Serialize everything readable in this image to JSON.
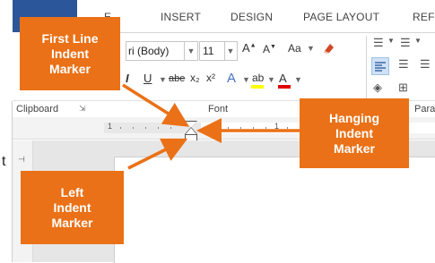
{
  "ribbon": {
    "tabs": [
      "E",
      "INSERT",
      "DESIGN",
      "PAGE LAYOUT",
      "REF"
    ],
    "font": {
      "name_value": "ri (Body)",
      "size_value": "11",
      "grow_label": "A",
      "shrink_label": "A",
      "case_label": "Aa",
      "italic_label": "I",
      "underline_label": "U",
      "strike_label": "abe",
      "subscript_label": "x₂",
      "superscript_label": "x²",
      "effect_label": "A",
      "highlight_label": "ab",
      "fontcolor_label": "A",
      "highlight_color": "#ffff00",
      "fontcolor_color": "#e00000"
    },
    "group_labels": {
      "clipboard": "Clipboard",
      "font": "Font",
      "paragraph": "Para"
    }
  },
  "ruler": {
    "numbers": [
      "1",
      "1"
    ]
  },
  "document": {
    "stray_char": "t"
  },
  "callouts": {
    "first_line": "First Line Indent Marker",
    "hanging": "Hanging Indent Marker",
    "left": "Left Indent Marker",
    "color": "#ea7117"
  }
}
